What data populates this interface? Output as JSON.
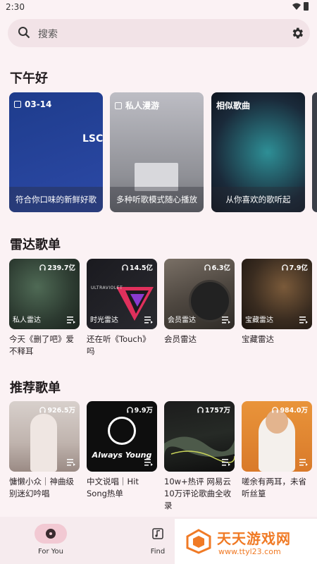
{
  "status_bar": {
    "time": "2:30"
  },
  "search": {
    "placeholder": "搜索"
  },
  "greeting": "下午好",
  "daily_cards": [
    {
      "head": "03-14",
      "caption": "符合你口味的新鲜好歌",
      "cover_text": "LSC"
    },
    {
      "head": "私人漫游",
      "caption": "多种听歌模式随心播放"
    },
    {
      "head": "相似歌曲",
      "caption": "从你喜欢的歌听起"
    }
  ],
  "radar_section": {
    "title": "雷达歌单",
    "items": [
      {
        "count": "239.7亿",
        "overlay": "私人雷达",
        "title": "今天《删了吧》爱不释耳"
      },
      {
        "count": "14.5亿",
        "overlay": "时光雷达",
        "title": "还在听《Touch》吗",
        "cover_text": "ULTRAVIOLET"
      },
      {
        "count": "6.3亿",
        "overlay": "会员雷达",
        "title": "会员雷达"
      },
      {
        "count": "7.9亿",
        "overlay": "宝藏雷达",
        "title": "宝藏雷达"
      }
    ]
  },
  "recommend_section": {
    "title": "推荐歌单",
    "items": [
      {
        "count": "926.5万",
        "title": "慵懒小众｜神曲级别迷幻吟唱"
      },
      {
        "count": "9.9万",
        "title": "中文说唱｜Hit Song热单",
        "cover_text": "Always Young"
      },
      {
        "count": "1757万",
        "title": "10w+热评 网易云10万评论歌曲全收录"
      },
      {
        "count": "984.0万",
        "title": "嗟余有两耳，未省听丝篁"
      }
    ]
  },
  "bottom_nav": {
    "items": [
      {
        "label": "For You"
      },
      {
        "label": "Find"
      }
    ]
  },
  "watermark": {
    "title": "天天游戏网",
    "url": "www.ttyl23.com"
  },
  "colors": {
    "accent": "#f2c9d3",
    "background": "#fbf2f4",
    "watermark": "#f07a25"
  }
}
